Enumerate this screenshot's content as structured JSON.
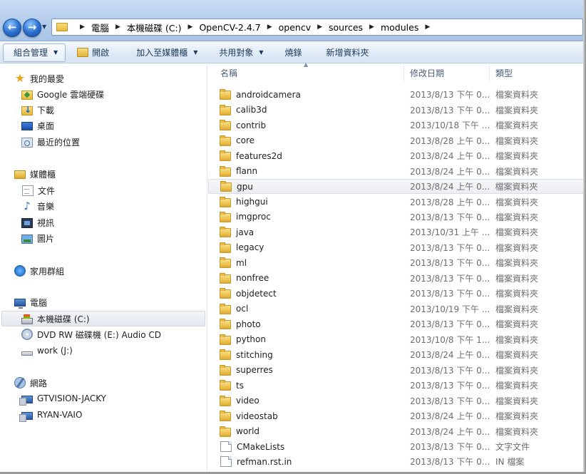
{
  "address_bar": {
    "crumbs": [
      "電腦",
      "本機磁碟 (C:)",
      "OpenCV-2.4.7",
      "opencv",
      "sources",
      "modules"
    ]
  },
  "toolbar": {
    "organize": "組合管理",
    "open": "開啟",
    "add_to_library": "加入至媒體櫃",
    "share": "共用對象",
    "burn": "燒錄",
    "new_folder": "新增資料夾"
  },
  "sidebar": {
    "favorites": {
      "label": "我的最愛",
      "items": [
        "Google 雲端硬碟",
        "下載",
        "桌面",
        "最近的位置"
      ]
    },
    "libraries": {
      "label": "媒體櫃",
      "items": [
        "文件",
        "音樂",
        "視訊",
        "圖片"
      ]
    },
    "homegroup": {
      "label": "家用群組"
    },
    "computer": {
      "label": "電腦",
      "items": [
        "本機磁碟 (C:)",
        "DVD RW 磁碟機 (E:) Audio CD",
        "work (J:)"
      ]
    },
    "network": {
      "label": "網路",
      "items": [
        "GTVISION-JACKY",
        "RYAN-VAIO"
      ]
    }
  },
  "columns": {
    "name": "名稱",
    "date": "修改日期",
    "type": "類型"
  },
  "files": [
    {
      "name": "androidcamera",
      "date": "2013/8/13 下午 0...",
      "type": "檔案資料夾",
      "icon": "folder-icon"
    },
    {
      "name": "calib3d",
      "date": "2013/8/13 下午 0...",
      "type": "檔案資料夾",
      "icon": "folder-icon"
    },
    {
      "name": "contrib",
      "date": "2013/10/18 下午 ...",
      "type": "檔案資料夾",
      "icon": "folder-icon"
    },
    {
      "name": "core",
      "date": "2013/8/28 上午 0...",
      "type": "檔案資料夾",
      "icon": "folder-icon"
    },
    {
      "name": "features2d",
      "date": "2013/8/24 上午 0...",
      "type": "檔案資料夾",
      "icon": "folder-icon"
    },
    {
      "name": "flann",
      "date": "2013/8/24 上午 0...",
      "type": "檔案資料夾",
      "icon": "folder-icon"
    },
    {
      "name": "gpu",
      "date": "2013/8/24 上午 0...",
      "type": "檔案資料夾",
      "icon": "folder-icon"
    },
    {
      "name": "highgui",
      "date": "2013/8/28 上午 0...",
      "type": "檔案資料夾",
      "icon": "folder-icon"
    },
    {
      "name": "imgproc",
      "date": "2013/8/13 下午 0...",
      "type": "檔案資料夾",
      "icon": "folder-icon"
    },
    {
      "name": "java",
      "date": "2013/10/31 上午 ...",
      "type": "檔案資料夾",
      "icon": "folder-icon"
    },
    {
      "name": "legacy",
      "date": "2013/8/13 下午 0...",
      "type": "檔案資料夾",
      "icon": "folder-icon"
    },
    {
      "name": "ml",
      "date": "2013/8/13 下午 0...",
      "type": "檔案資料夾",
      "icon": "folder-icon"
    },
    {
      "name": "nonfree",
      "date": "2013/8/13 下午 0...",
      "type": "檔案資料夾",
      "icon": "folder-icon"
    },
    {
      "name": "objdetect",
      "date": "2013/8/13 下午 0...",
      "type": "檔案資料夾",
      "icon": "folder-icon"
    },
    {
      "name": "ocl",
      "date": "2013/10/19 下午 ...",
      "type": "檔案資料夾",
      "icon": "folder-icon"
    },
    {
      "name": "photo",
      "date": "2013/8/13 下午 0...",
      "type": "檔案資料夾",
      "icon": "folder-icon"
    },
    {
      "name": "python",
      "date": "2013/10/8 下午 1...",
      "type": "檔案資料夾",
      "icon": "folder-icon"
    },
    {
      "name": "stitching",
      "date": "2013/8/24 上午 0...",
      "type": "檔案資料夾",
      "icon": "folder-icon"
    },
    {
      "name": "superres",
      "date": "2013/8/13 下午 0...",
      "type": "檔案資料夾",
      "icon": "folder-icon"
    },
    {
      "name": "ts",
      "date": "2013/8/13 下午 0...",
      "type": "檔案資料夾",
      "icon": "folder-icon"
    },
    {
      "name": "video",
      "date": "2013/8/13 下午 0...",
      "type": "檔案資料夾",
      "icon": "folder-icon"
    },
    {
      "name": "videostab",
      "date": "2013/8/24 上午 0...",
      "type": "檔案資料夾",
      "icon": "folder-icon"
    },
    {
      "name": "world",
      "date": "2013/8/24 上午 0...",
      "type": "檔案資料夾",
      "icon": "folder-icon"
    },
    {
      "name": "CMakeLists",
      "date": "2013/8/13 下午 0...",
      "type": "文字文件",
      "icon": "text-file-icon"
    },
    {
      "name": "refman.rst.in",
      "date": "2013/8/13 下午 0...",
      "type": "IN 檔案",
      "icon": "file-icon"
    }
  ]
}
